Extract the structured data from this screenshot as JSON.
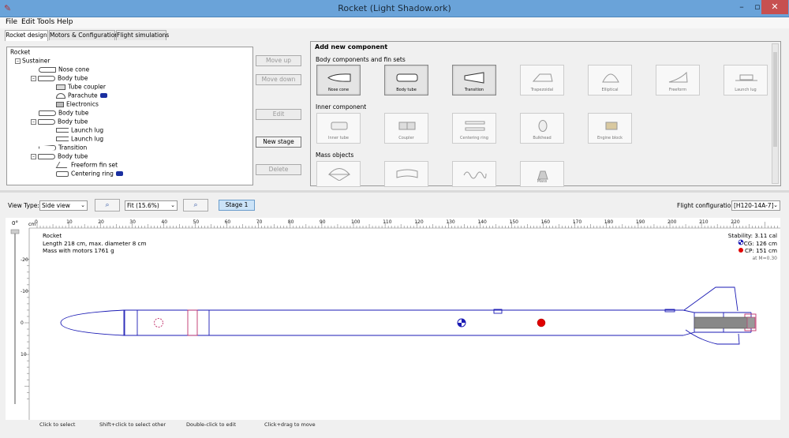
{
  "window": {
    "title": "Rocket (Light Shadow.ork)"
  },
  "menu": [
    "File",
    "Edit",
    "Tools",
    "Help"
  ],
  "tabs": [
    "Rocket design",
    "Motors & Configuration",
    "Flight simulations"
  ],
  "tree": [
    {
      "label": "Rocket",
      "icon": "none"
    },
    {
      "label": "Sustainer",
      "icon": "none"
    },
    {
      "label": "Nose cone",
      "icon": "nose-cone-icon"
    },
    {
      "label": "Body tube",
      "icon": "body-tube-icon"
    },
    {
      "label": "Tube coupler",
      "icon": "tube-coupler-icon"
    },
    {
      "label": "Parachute",
      "icon": "parachute-icon",
      "badge": true
    },
    {
      "label": "Electronics",
      "icon": "mass-object-icon"
    },
    {
      "label": "Body tube",
      "icon": "body-tube-icon"
    },
    {
      "label": "Body tube",
      "icon": "body-tube-icon"
    },
    {
      "label": "Launch lug",
      "icon": "launch-lug-icon"
    },
    {
      "label": "Launch lug",
      "icon": "launch-lug-icon"
    },
    {
      "label": "Transition",
      "icon": "transition-icon"
    },
    {
      "label": "Body tube",
      "icon": "body-tube-icon"
    },
    {
      "label": "Freeform fin set",
      "icon": "freeform-fin-icon"
    },
    {
      "label": "Centering ring",
      "icon": "centering-ring-icon",
      "badge": true
    }
  ],
  "actions": {
    "move_up": "Move up",
    "move_down": "Move down",
    "edit": "Edit",
    "new_stage": "New stage",
    "delete": "Delete"
  },
  "components": {
    "title": "Add new component",
    "sections": [
      "Body components and fin sets",
      "Inner component",
      "Mass objects"
    ],
    "body": [
      "Nose cone",
      "Body tube",
      "Transition",
      "Trapezoidal",
      "Elliptical",
      "Freeform",
      "Launch lug"
    ],
    "inner": [
      "Inner tube",
      "Coupler",
      "Centering ring",
      "Bulkhead",
      "Engine block"
    ],
    "mass": [
      "",
      "",
      "",
      "Mass"
    ]
  },
  "view": {
    "view_type_label": "View Type:",
    "view_type_value": "Side view",
    "zoom_value": "Fit (15.6%)",
    "stage_label": "Stage 1",
    "flight_config_label": "Flight configuration:",
    "flight_config_value": "[H120-14A-7]"
  },
  "ruler": {
    "angle": "0°",
    "unit": "cm",
    "x_labels": [
      "0",
      "10",
      "20",
      "30",
      "40",
      "50",
      "60",
      "70",
      "80",
      "90",
      "100",
      "110",
      "120",
      "130",
      "140",
      "150",
      "160",
      "170",
      "180",
      "190",
      "200",
      "210",
      "220"
    ],
    "y_labels": [
      "-20",
      "-10",
      "0",
      "10"
    ]
  },
  "rocket_info": {
    "name": "Rocket",
    "size": "Length 218 cm, max. diameter 8 cm",
    "mass": "Mass with motors 1761 g"
  },
  "stability": {
    "stability": "Stability: 3.11 cal",
    "cg": "CG: 126 cm",
    "cp": "CP: 151 cm",
    "mach": "at M=0.30"
  },
  "status": [
    "Click to select",
    "Shift+click to select other",
    "Double-click to edit",
    "Click+drag to move"
  ],
  "colors": {
    "outline": "#1a1ab4",
    "inner": "#c0306a",
    "cp": "#e00000",
    "titlebar": "#6aa3d9"
  }
}
